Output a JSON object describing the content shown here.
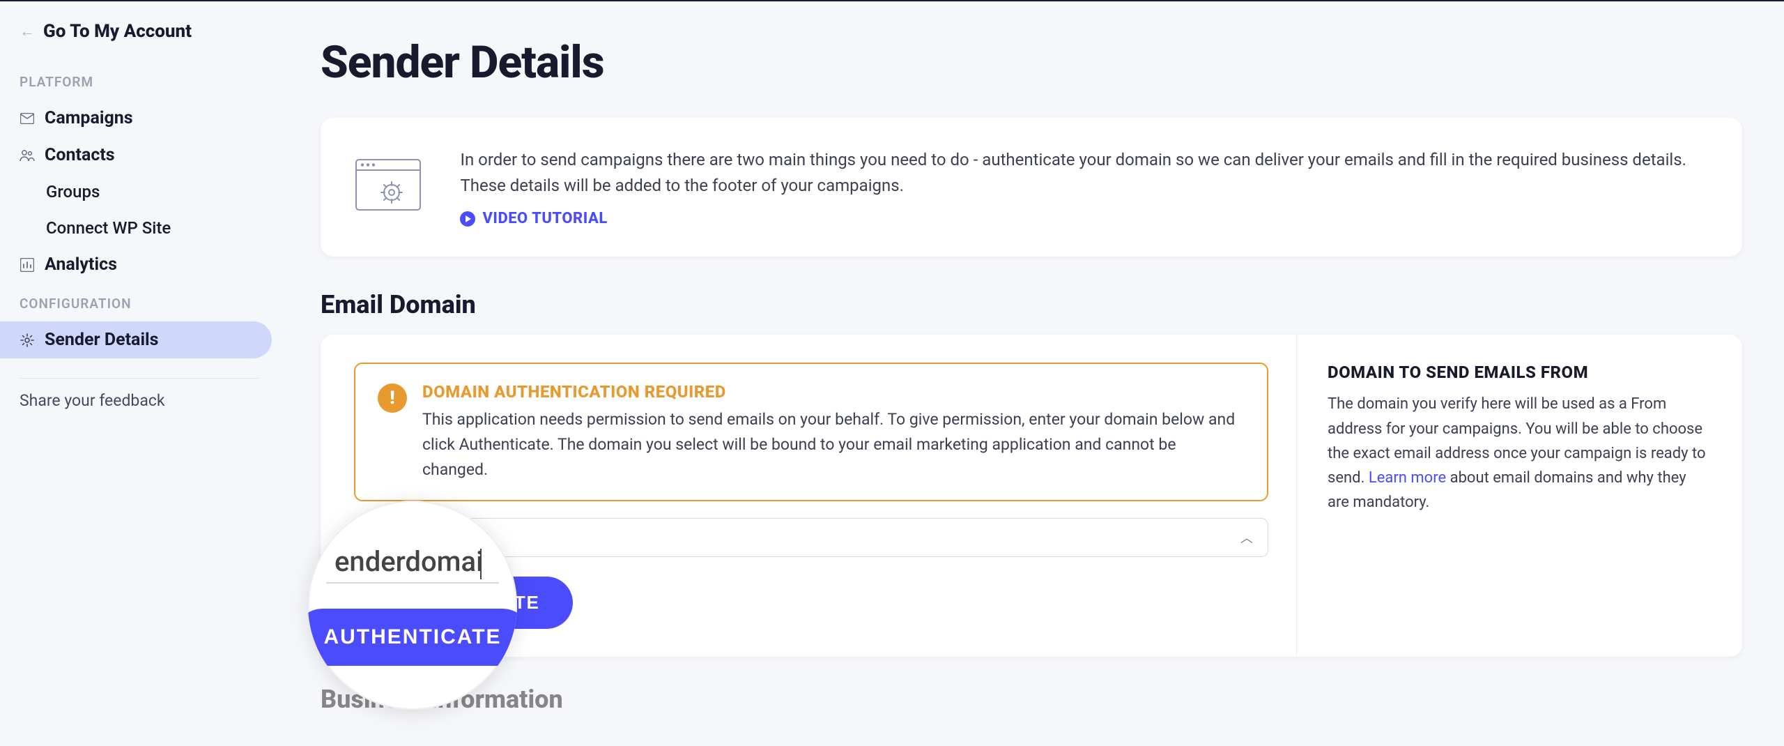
{
  "nav": {
    "go_back": "Go To My Account",
    "platform_label": "PLATFORM",
    "configuration_label": "CONFIGURATION",
    "items": {
      "campaigns": "Campaigns",
      "contacts": "Contacts",
      "groups": "Groups",
      "connect_wp": "Connect WP Site",
      "analytics": "Analytics",
      "sender_details": "Sender Details"
    },
    "feedback": "Share your feedback"
  },
  "page": {
    "title": "Sender Details",
    "intro_text": "In order to send campaigns there are two main things you need to do - authenticate your domain so we can deliver your emails and fill in the required business details. These details will be added to the footer of your campaigns.",
    "video_tutorial": "VIDEO TUTORIAL",
    "email_domain_heading": "Email Domain",
    "business_info_heading": "Business Information"
  },
  "alert": {
    "title": "DOMAIN AUTHENTICATION REQUIRED",
    "body": "This application needs permission to send emails on your behalf. To give permission, enter your domain below and click Authenticate. The domain you select will be bound to your email marketing application and cannot be changed."
  },
  "domain_input": {
    "value": "",
    "placeholder": ""
  },
  "authenticate_label": "AUTHENTICATE",
  "info_panel": {
    "title": "DOMAIN TO SEND EMAILS FROM",
    "body_pre": "The domain you verify here will be used as a From address for your campaigns. You will be able to choose the exact email address once your campaign is ready to send. ",
    "learn_more": "Learn more",
    "body_post": " about email domains and why they are mandatory."
  },
  "zoom": {
    "text": "enderdomai",
    "button": "AUTHENTICATE"
  }
}
